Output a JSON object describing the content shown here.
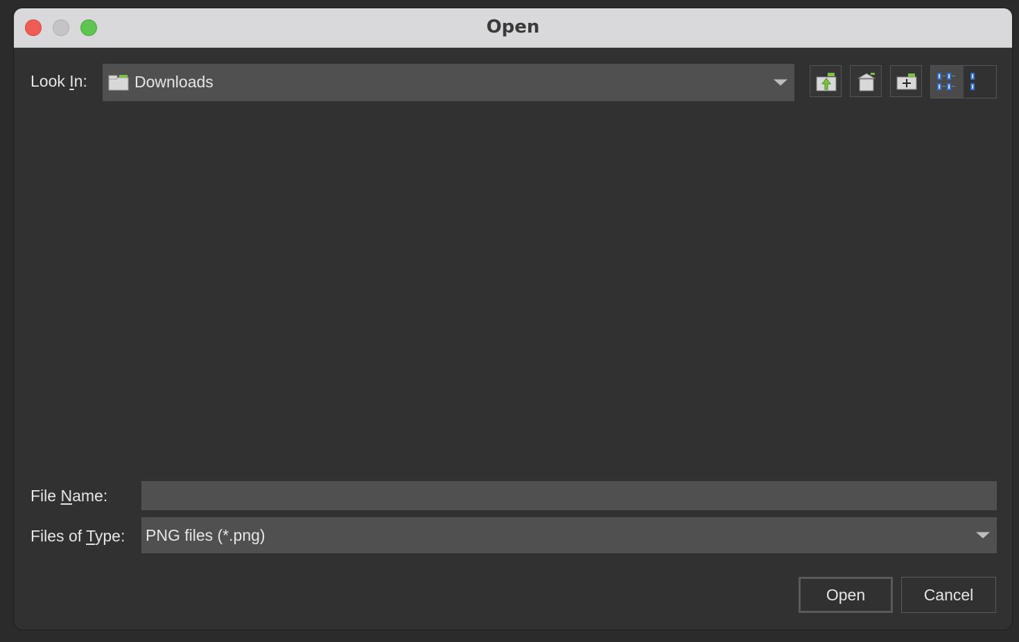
{
  "window": {
    "title": "Open"
  },
  "look_in": {
    "label_prefix": "Look ",
    "label_mnemonic": "I",
    "label_suffix": "n:",
    "value": "Downloads"
  },
  "toolbar": {
    "icons": [
      "up-folder-icon",
      "home-icon",
      "new-folder-icon",
      "list-view-icon",
      "details-view-icon"
    ]
  },
  "file_name": {
    "label_prefix": "File ",
    "label_mnemonic": "N",
    "label_suffix": "ame:",
    "value": "",
    "placeholder": ""
  },
  "file_type": {
    "label_prefix": "Files of ",
    "label_mnemonic": "T",
    "label_suffix": "ype:",
    "value": "PNG files (*.png)"
  },
  "buttons": {
    "open": "Open",
    "cancel": "Cancel"
  },
  "colors": {
    "background": "#313131",
    "field": "#505050",
    "accent_green": "#7fc241",
    "accent_blue": "#2f6fdc",
    "close": "#ee5c55",
    "maximize": "#5fc452"
  }
}
